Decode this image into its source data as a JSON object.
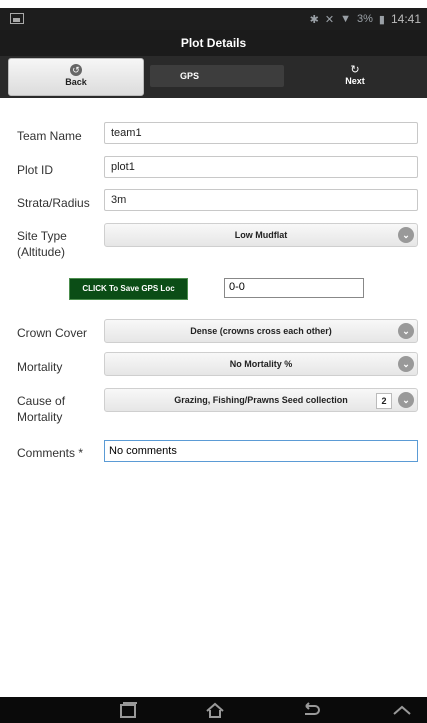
{
  "status": {
    "battery": "3%",
    "time": "14:41"
  },
  "header": {
    "title": "Plot Details"
  },
  "toolbar": {
    "back_label": "Back",
    "gps_label": "GPS",
    "next_label": "Next"
  },
  "form": {
    "team_name": {
      "label": "Team Name",
      "value": "team1"
    },
    "plot_id": {
      "label": "Plot ID",
      "value": "plot1"
    },
    "strata_radius": {
      "label": "Strata/Radius",
      "value": "3m"
    },
    "site_type": {
      "label_line1": "Site Type",
      "label_line2": "(Altitude)",
      "value": "Low Mudflat"
    },
    "gps": {
      "button_label": "CLICK To Save GPS Loc",
      "value": "0-0"
    },
    "crown_cover": {
      "label": "Crown Cover",
      "value": "Dense (crowns cross each other)"
    },
    "mortality": {
      "label": "Mortality",
      "value": "No Mortality %"
    },
    "cause_of_mortality": {
      "label_line1": "Cause of",
      "label_line2": "Mortality",
      "value": "Grazing, Fishing/Prawns Seed collection",
      "count": "2"
    },
    "comments": {
      "label": "Comments *",
      "value": "No comments"
    }
  },
  "icons": {
    "back": "back-icon",
    "next": "next-icon",
    "chevron": "chevron-down-icon",
    "nav": [
      "recent-apps-icon",
      "home-icon",
      "back-nav-icon",
      "up-icon"
    ]
  }
}
